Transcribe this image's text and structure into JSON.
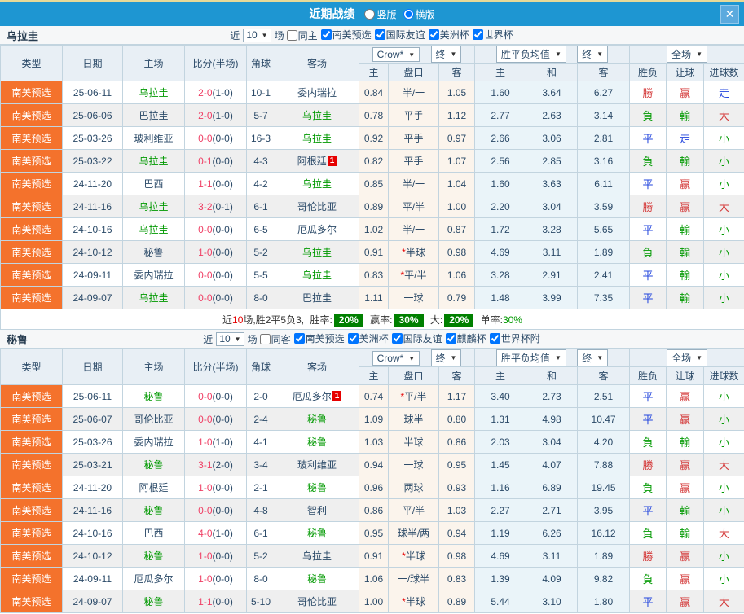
{
  "colors": {
    "titlebar_blue": "#1e96d2",
    "type_orange": "#f4722c",
    "team_green": "#009900",
    "score_red": "#ef4166",
    "star_red": "#e60000",
    "badge_red": "#e60000",
    "result_red": "#d43a3a",
    "result_green": "#009900",
    "result_blue": "#2244dd",
    "summary_badge_green": "#008000",
    "header_bg": "#e8eff5",
    "odds_bg": "#fbf4ec",
    "mean_bg": "#eaf4f9"
  },
  "titlebar": {
    "title": "近期战绩",
    "layout_vertical": "竖版",
    "layout_horizontal": "横版",
    "close_glyph": "✕"
  },
  "filter_labels": {
    "near": "近",
    "games": "场"
  },
  "table_header": {
    "type": "类型",
    "date": "日期",
    "home": "主场",
    "score": "比分(半场)",
    "corner": "角球",
    "away": "客场",
    "dd_bookmaker": "Crow*",
    "dd_final": "终",
    "dd_odds_mean": "胜平负均值",
    "dd_final2": "终",
    "dd_scope": "全场",
    "sub_home": "主",
    "sub_handicap": "盘口",
    "sub_away": "客",
    "sub_mean_home": "主",
    "sub_mean_draw": "和",
    "sub_mean_away": "客",
    "sub_result": "胜负",
    "sub_handicap_result": "让球",
    "sub_goals": "进球数"
  },
  "sections": [
    {
      "team": "乌拉圭",
      "filter": {
        "count": "10",
        "same_label": "同主",
        "same_checked": false,
        "competitions": [
          "南美预选",
          "国际友谊",
          "美洲杯",
          "世界杯"
        ]
      },
      "rows": [
        {
          "type": "南美预选",
          "date": "25-06-11",
          "home": "乌拉圭",
          "home_focus": true,
          "home_badge": "",
          "score": "2-0",
          "half": "(1-0)",
          "corner": "10-1",
          "away": "委内瑞拉",
          "away_focus": false,
          "away_badge": "",
          "odds_home": "0.84",
          "handicap": "半/一",
          "odds_away": "1.05",
          "mean_home": "1.60",
          "mean_draw": "3.64",
          "mean_away": "6.27",
          "res_wdl": "勝",
          "res_wdl_color": "red",
          "res_handicap": "赢",
          "res_handicap_color": "red",
          "res_goals": "走",
          "res_goals_color": "blue"
        },
        {
          "type": "南美预选",
          "date": "25-06-06",
          "home": "巴拉圭",
          "home_focus": false,
          "home_badge": "",
          "score": "2-0",
          "half": "(1-0)",
          "corner": "5-7",
          "away": "乌拉圭",
          "away_focus": true,
          "away_badge": "",
          "odds_home": "0.78",
          "handicap": "平手",
          "odds_away": "1.12",
          "mean_home": "2.77",
          "mean_draw": "2.63",
          "mean_away": "3.14",
          "res_wdl": "負",
          "res_wdl_color": "green",
          "res_handicap": "輸",
          "res_handicap_color": "green",
          "res_goals": "大",
          "res_goals_color": "red"
        },
        {
          "type": "南美预选",
          "date": "25-03-26",
          "home": "玻利维亚",
          "home_focus": false,
          "home_badge": "",
          "score": "0-0",
          "half": "(0-0)",
          "corner": "16-3",
          "away": "乌拉圭",
          "away_focus": true,
          "away_badge": "",
          "odds_home": "0.92",
          "handicap": "平手",
          "odds_away": "0.97",
          "mean_home": "2.66",
          "mean_draw": "3.06",
          "mean_away": "2.81",
          "res_wdl": "平",
          "res_wdl_color": "blue",
          "res_handicap": "走",
          "res_handicap_color": "blue",
          "res_goals": "小",
          "res_goals_color": "green"
        },
        {
          "type": "南美预选",
          "date": "25-03-22",
          "home": "乌拉圭",
          "home_focus": true,
          "home_badge": "",
          "score": "0-1",
          "half": "(0-0)",
          "corner": "4-3",
          "away": "阿根廷",
          "away_focus": false,
          "away_badge": "1",
          "odds_home": "0.82",
          "handicap": "平手",
          "odds_away": "1.07",
          "mean_home": "2.56",
          "mean_draw": "2.85",
          "mean_away": "3.16",
          "res_wdl": "負",
          "res_wdl_color": "green",
          "res_handicap": "輸",
          "res_handicap_color": "green",
          "res_goals": "小",
          "res_goals_color": "green"
        },
        {
          "type": "南美预选",
          "date": "24-11-20",
          "home": "巴西",
          "home_focus": false,
          "home_badge": "",
          "score": "1-1",
          "half": "(0-0)",
          "corner": "4-2",
          "away": "乌拉圭",
          "away_focus": true,
          "away_badge": "",
          "odds_home": "0.85",
          "handicap": "半/一",
          "odds_away": "1.04",
          "mean_home": "1.60",
          "mean_draw": "3.63",
          "mean_away": "6.11",
          "res_wdl": "平",
          "res_wdl_color": "blue",
          "res_handicap": "赢",
          "res_handicap_color": "red",
          "res_goals": "小",
          "res_goals_color": "green"
        },
        {
          "type": "南美预选",
          "date": "24-11-16",
          "home": "乌拉圭",
          "home_focus": true,
          "home_badge": "",
          "score": "3-2",
          "half": "(0-1)",
          "corner": "6-1",
          "away": "哥伦比亚",
          "away_focus": false,
          "away_badge": "",
          "odds_home": "0.89",
          "handicap": "平/半",
          "odds_away": "1.00",
          "mean_home": "2.20",
          "mean_draw": "3.04",
          "mean_away": "3.59",
          "res_wdl": "勝",
          "res_wdl_color": "red",
          "res_handicap": "赢",
          "res_handicap_color": "red",
          "res_goals": "大",
          "res_goals_color": "red"
        },
        {
          "type": "南美预选",
          "date": "24-10-16",
          "home": "乌拉圭",
          "home_focus": true,
          "home_badge": "",
          "score": "0-0",
          "half": "(0-0)",
          "corner": "6-5",
          "away": "厄瓜多尔",
          "away_focus": false,
          "away_badge": "",
          "odds_home": "1.02",
          "handicap": "半/一",
          "odds_away": "0.87",
          "mean_home": "1.72",
          "mean_draw": "3.28",
          "mean_away": "5.65",
          "res_wdl": "平",
          "res_wdl_color": "blue",
          "res_handicap": "輸",
          "res_handicap_color": "green",
          "res_goals": "小",
          "res_goals_color": "green"
        },
        {
          "type": "南美预选",
          "date": "24-10-12",
          "home": "秘鲁",
          "home_focus": false,
          "home_badge": "",
          "score": "1-0",
          "half": "(0-0)",
          "corner": "5-2",
          "away": "乌拉圭",
          "away_focus": true,
          "away_badge": "",
          "odds_home": "0.91",
          "handicap": "*半球",
          "odds_away": "0.98",
          "mean_home": "4.69",
          "mean_draw": "3.11",
          "mean_away": "1.89",
          "res_wdl": "負",
          "res_wdl_color": "green",
          "res_handicap": "輸",
          "res_handicap_color": "green",
          "res_goals": "小",
          "res_goals_color": "green"
        },
        {
          "type": "南美预选",
          "date": "24-09-11",
          "home": "委内瑞拉",
          "home_focus": false,
          "home_badge": "",
          "score": "0-0",
          "half": "(0-0)",
          "corner": "5-5",
          "away": "乌拉圭",
          "away_focus": true,
          "away_badge": "",
          "odds_home": "0.83",
          "handicap": "*平/半",
          "odds_away": "1.06",
          "mean_home": "3.28",
          "mean_draw": "2.91",
          "mean_away": "2.41",
          "res_wdl": "平",
          "res_wdl_color": "blue",
          "res_handicap": "輸",
          "res_handicap_color": "green",
          "res_goals": "小",
          "res_goals_color": "green"
        },
        {
          "type": "南美预选",
          "date": "24-09-07",
          "home": "乌拉圭",
          "home_focus": true,
          "home_badge": "",
          "score": "0-0",
          "half": "(0-0)",
          "corner": "8-0",
          "away": "巴拉圭",
          "away_focus": false,
          "away_badge": "",
          "odds_home": "1.11",
          "handicap": "一球",
          "odds_away": "0.79",
          "mean_home": "1.48",
          "mean_draw": "3.99",
          "mean_away": "7.35",
          "res_wdl": "平",
          "res_wdl_color": "blue",
          "res_handicap": "輸",
          "res_handicap_color": "green",
          "res_goals": "小",
          "res_goals_color": "green"
        }
      ],
      "summary": {
        "prefix": "近",
        "count": "10",
        "mid": "场,胜2平5负3,",
        "win_label": "胜率:",
        "win_badge": "20%",
        "cover_label": "赢率:",
        "cover_badge": "30%",
        "big_label": "大:",
        "big_badge": "20%",
        "single_label": "单率:",
        "single_value": "30%"
      }
    },
    {
      "team": "秘鲁",
      "filter": {
        "count": "10",
        "same_label": "同客",
        "same_checked": false,
        "competitions": [
          "南美预选",
          "美洲杯",
          "国际友谊",
          "麒麟杯",
          "世界杯附"
        ]
      },
      "rows": [
        {
          "type": "南美预选",
          "date": "25-06-11",
          "home": "秘鲁",
          "home_focus": true,
          "home_badge": "",
          "score": "0-0",
          "half": "(0-0)",
          "corner": "2-0",
          "away": "厄瓜多尔",
          "away_focus": false,
          "away_badge": "1",
          "odds_home": "0.74",
          "handicap": "*平/半",
          "odds_away": "1.17",
          "mean_home": "3.40",
          "mean_draw": "2.73",
          "mean_away": "2.51",
          "res_wdl": "平",
          "res_wdl_color": "blue",
          "res_handicap": "赢",
          "res_handicap_color": "red",
          "res_goals": "小",
          "res_goals_color": "green"
        },
        {
          "type": "南美预选",
          "date": "25-06-07",
          "home": "哥伦比亚",
          "home_focus": false,
          "home_badge": "",
          "score": "0-0",
          "half": "(0-0)",
          "corner": "2-4",
          "away": "秘鲁",
          "away_focus": true,
          "away_badge": "",
          "odds_home": "1.09",
          "handicap": "球半",
          "odds_away": "0.80",
          "mean_home": "1.31",
          "mean_draw": "4.98",
          "mean_away": "10.47",
          "res_wdl": "平",
          "res_wdl_color": "blue",
          "res_handicap": "赢",
          "res_handicap_color": "red",
          "res_goals": "小",
          "res_goals_color": "green"
        },
        {
          "type": "南美预选",
          "date": "25-03-26",
          "home": "委内瑞拉",
          "home_focus": false,
          "home_badge": "",
          "score": "1-0",
          "half": "(1-0)",
          "corner": "4-1",
          "away": "秘鲁",
          "away_focus": true,
          "away_badge": "",
          "odds_home": "1.03",
          "handicap": "半球",
          "odds_away": "0.86",
          "mean_home": "2.03",
          "mean_draw": "3.04",
          "mean_away": "4.20",
          "res_wdl": "負",
          "res_wdl_color": "green",
          "res_handicap": "輸",
          "res_handicap_color": "green",
          "res_goals": "小",
          "res_goals_color": "green"
        },
        {
          "type": "南美预选",
          "date": "25-03-21",
          "home": "秘鲁",
          "home_focus": true,
          "home_badge": "",
          "score": "3-1",
          "half": "(2-0)",
          "corner": "3-4",
          "away": "玻利维亚",
          "away_focus": false,
          "away_badge": "",
          "odds_home": "0.94",
          "handicap": "一球",
          "odds_away": "0.95",
          "mean_home": "1.45",
          "mean_draw": "4.07",
          "mean_away": "7.88",
          "res_wdl": "勝",
          "res_wdl_color": "red",
          "res_handicap": "赢",
          "res_handicap_color": "red",
          "res_goals": "大",
          "res_goals_color": "red"
        },
        {
          "type": "南美预选",
          "date": "24-11-20",
          "home": "阿根廷",
          "home_focus": false,
          "home_badge": "",
          "score": "1-0",
          "half": "(0-0)",
          "corner": "2-1",
          "away": "秘鲁",
          "away_focus": true,
          "away_badge": "",
          "odds_home": "0.96",
          "handicap": "两球",
          "odds_away": "0.93",
          "mean_home": "1.16",
          "mean_draw": "6.89",
          "mean_away": "19.45",
          "res_wdl": "負",
          "res_wdl_color": "green",
          "res_handicap": "赢",
          "res_handicap_color": "red",
          "res_goals": "小",
          "res_goals_color": "green"
        },
        {
          "type": "南美预选",
          "date": "24-11-16",
          "home": "秘鲁",
          "home_focus": true,
          "home_badge": "",
          "score": "0-0",
          "half": "(0-0)",
          "corner": "4-8",
          "away": "智利",
          "away_focus": false,
          "away_badge": "",
          "odds_home": "0.86",
          "handicap": "平/半",
          "odds_away": "1.03",
          "mean_home": "2.27",
          "mean_draw": "2.71",
          "mean_away": "3.95",
          "res_wdl": "平",
          "res_wdl_color": "blue",
          "res_handicap": "輸",
          "res_handicap_color": "green",
          "res_goals": "小",
          "res_goals_color": "green"
        },
        {
          "type": "南美预选",
          "date": "24-10-16",
          "home": "巴西",
          "home_focus": false,
          "home_badge": "",
          "score": "4-0",
          "half": "(1-0)",
          "corner": "6-1",
          "away": "秘鲁",
          "away_focus": true,
          "away_badge": "",
          "odds_home": "0.95",
          "handicap": "球半/两",
          "odds_away": "0.94",
          "mean_home": "1.19",
          "mean_draw": "6.26",
          "mean_away": "16.12",
          "res_wdl": "負",
          "res_wdl_color": "green",
          "res_handicap": "輸",
          "res_handicap_color": "green",
          "res_goals": "大",
          "res_goals_color": "red"
        },
        {
          "type": "南美预选",
          "date": "24-10-12",
          "home": "秘鲁",
          "home_focus": true,
          "home_badge": "",
          "score": "1-0",
          "half": "(0-0)",
          "corner": "5-2",
          "away": "乌拉圭",
          "away_focus": false,
          "away_badge": "",
          "odds_home": "0.91",
          "handicap": "*半球",
          "odds_away": "0.98",
          "mean_home": "4.69",
          "mean_draw": "3.11",
          "mean_away": "1.89",
          "res_wdl": "勝",
          "res_wdl_color": "red",
          "res_handicap": "赢",
          "res_handicap_color": "red",
          "res_goals": "小",
          "res_goals_color": "green"
        },
        {
          "type": "南美预选",
          "date": "24-09-11",
          "home": "厄瓜多尔",
          "home_focus": false,
          "home_badge": "",
          "score": "1-0",
          "half": "(0-0)",
          "corner": "8-0",
          "away": "秘鲁",
          "away_focus": true,
          "away_badge": "",
          "odds_home": "1.06",
          "handicap": "一/球半",
          "odds_away": "0.83",
          "mean_home": "1.39",
          "mean_draw": "4.09",
          "mean_away": "9.82",
          "res_wdl": "負",
          "res_wdl_color": "green",
          "res_handicap": "赢",
          "res_handicap_color": "red",
          "res_goals": "小",
          "res_goals_color": "green"
        },
        {
          "type": "南美预选",
          "date": "24-09-07",
          "home": "秘鲁",
          "home_focus": true,
          "home_badge": "",
          "score": "1-1",
          "half": "(0-0)",
          "corner": "5-10",
          "away": "哥伦比亚",
          "away_focus": false,
          "away_badge": "",
          "odds_home": "1.00",
          "handicap": "*半球",
          "odds_away": "0.89",
          "mean_home": "5.44",
          "mean_draw": "3.10",
          "mean_away": "1.80",
          "res_wdl": "平",
          "res_wdl_color": "blue",
          "res_handicap": "赢",
          "res_handicap_color": "red",
          "res_goals": "大",
          "res_goals_color": "red"
        }
      ]
    }
  ]
}
